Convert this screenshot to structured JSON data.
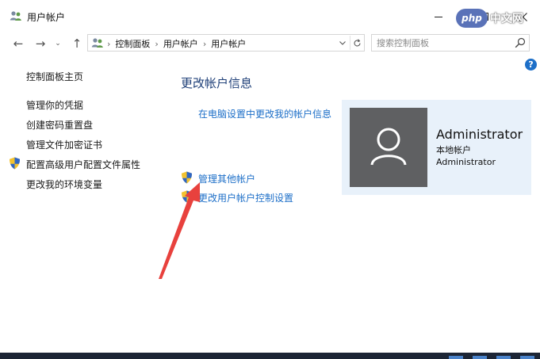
{
  "window": {
    "title": "用户帐户"
  },
  "navigation": {
    "back_icon": "←",
    "forward_icon": "→",
    "recent_icon": "⌄",
    "up_icon": "↑"
  },
  "address_bar": {
    "breadcrumbs": [
      "控制面板",
      "用户帐户",
      "用户帐户"
    ],
    "separator": "›"
  },
  "search": {
    "placeholder": "搜索控制面板"
  },
  "help": {
    "glyph": "?"
  },
  "sidebar": {
    "items": [
      {
        "label": "控制面板主页"
      },
      {
        "label": "管理你的凭据"
      },
      {
        "label": "创建密码重置盘"
      },
      {
        "label": "管理文件加密证书"
      },
      {
        "label": "配置高级用户配置文件属性"
      },
      {
        "label": "更改我的环境变量"
      }
    ]
  },
  "main": {
    "title": "更改帐户信息",
    "settings_link": "在电脑设置中更改我的帐户信息",
    "manage_other_link": "管理其他帐户",
    "uac_link": "更改用户帐户控制设置"
  },
  "account": {
    "name": "Administrator",
    "type": "本地帐户",
    "role": "Administrator"
  },
  "watermark": {
    "badge": "php",
    "text": "中文网"
  },
  "colors": {
    "link": "#1d6fc8",
    "title": "#1e3f78",
    "card_bg": "#e8f1fa",
    "avatar_bg": "#5f6062",
    "arrow": "#e8413d"
  }
}
